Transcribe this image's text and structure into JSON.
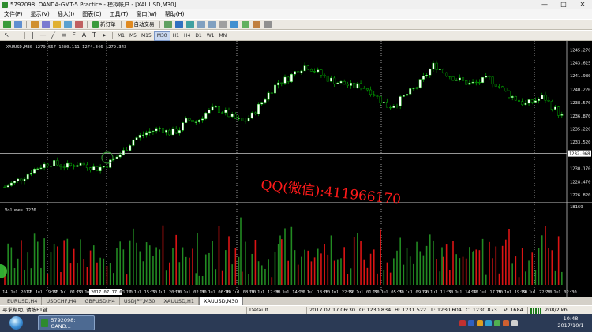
{
  "window": {
    "title": "5792098: OANDA-GMT-5 Practice - 模拟帐户 - [XAUUSD,M30]",
    "controls": [
      "—",
      "□",
      "✕"
    ]
  },
  "menu": [
    "文件(F)",
    "显示(V)",
    "插入(I)",
    "图表(C)",
    "工具(T)",
    "窗口(W)",
    "帮助(H)"
  ],
  "toolbar": {
    "new_order_label": "新订单",
    "auto_trade_label": "自动交易",
    "timeframes": [
      "M1",
      "M5",
      "M15",
      "M30",
      "H1",
      "H4",
      "D1",
      "W1",
      "MN"
    ],
    "active_timeframe": "M30"
  },
  "chart": {
    "header_text": "XAUUSD,M30  1279.567 1280.111 1274.346 1279.343",
    "volume_label": "Volumes 7276",
    "volume_max_label": "18169",
    "current_price_label": "1232.068",
    "crosshair_date_label": "2017.07.17 6:30",
    "watermark": "QQ(微信):411966170",
    "colors": {
      "bull": "#ffffff",
      "bear": "#000000",
      "bull_outline": "#00c800",
      "bear_outline": "#00c800",
      "volume_up": "#228b22",
      "volume_down": "#dc1414",
      "grid": "#ffffff",
      "watermark": "#ff1a1a"
    }
  },
  "chart_data": {
    "type": "candlestick",
    "symbol": "XAUUSD",
    "timeframe": "M30",
    "price_ticks": [
      "1245.270",
      "1243.625",
      "1241.980",
      "1240.220",
      "1238.570",
      "1236.870",
      "1235.220",
      "1233.520",
      "1231.870",
      "1230.170",
      "1228.470",
      "1226.820"
    ],
    "ylim": [
      1226.3,
      1245.6
    ],
    "x_ticks": [
      "14 Jul 2017",
      "16 Jul 19:30",
      "17 Jul 01:30",
      "17 Jul 07:30",
      "17 Jul 13:30",
      "17 Jul 15:30",
      "17 Jul 20:30",
      "18 Jul 02:30",
      "18 Jul 06:30",
      "18 Jul 08:30",
      "18 Jul 12:30",
      "18 Jul 14:30",
      "18 Jul 18:30",
      "18 Jul 22:30",
      "19 Jul 01:30",
      "19 Jul 05:30",
      "19 Jul 09:30",
      "19 Jul 11:30",
      "19 Jul 14:30",
      "19 Jul 17:30",
      "19 Jul 19:30",
      "19 Jul 22:30",
      "20 Jul 02:30"
    ],
    "close_path": [
      1227.8,
      1228.4,
      1229.0,
      1229.9,
      1230.5,
      1230.9,
      1230.6,
      1230.4,
      1230.8,
      1230.6,
      1230.1,
      1230.5,
      1231.4,
      1232.3,
      1233.8,
      1234.4,
      1234.9,
      1235.3,
      1234.7,
      1235.0,
      1236.4,
      1236.1,
      1237.2,
      1237.8,
      1237.4,
      1236.6,
      1236.1,
      1236.8,
      1238.4,
      1239.9,
      1241.2,
      1241.6,
      1242.7,
      1243.3,
      1242.6,
      1241.8,
      1241.3,
      1241.0,
      1240.6,
      1240.7,
      1240.1,
      1239.0,
      1238.0,
      1238.6,
      1239.6,
      1240.4,
      1241.9,
      1243.4,
      1242.5,
      1241.8,
      1241.3,
      1240.9,
      1241.2,
      1241.6,
      1240.8,
      1239.7,
      1239.0,
      1238.3,
      1238.8,
      1239.3,
      1238.0,
      1236.8
    ]
  },
  "tabs": [
    "EURUSD,H4",
    "USDCHF,H4",
    "GBPUSD,H4",
    "USDJPY,M30",
    "XAUUSD,H1",
    "XAUUSD,M30"
  ],
  "active_tab": "XAUUSD,M30",
  "status": {
    "help_text": "寻求帮助, 请按F1键",
    "profile": "Default",
    "datetime": "2017.07.17 06:30",
    "open": "O: 1230.834",
    "high": "H: 1231.522",
    "low": "L: 1230.604",
    "close": "C: 1230.873",
    "volume": "V: 1684",
    "traffic": "208/2 kb"
  },
  "taskbar": {
    "app_label": "5792098: OAND...",
    "time": "10:48",
    "date": "2017/10/1"
  }
}
